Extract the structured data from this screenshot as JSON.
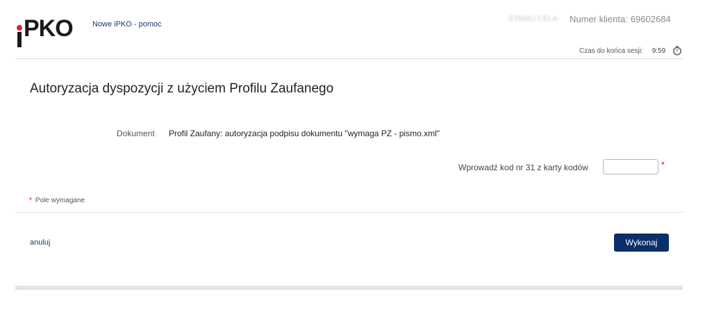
{
  "header": {
    "logo_text": "PKO",
    "logo_i": "i",
    "help_link": "Nowe iPKO - pomoc",
    "user_name": "STASIU CELA",
    "client_label": "Numer klienta:",
    "client_number": "69602684",
    "session_label": "Czas do końca sesji:",
    "session_time": "9:59",
    "timer_icon": "timer-icon"
  },
  "main": {
    "title": "Autoryzacja dyspozycji z użyciem Profilu Zaufanego",
    "document_label": "Dokument",
    "document_value": "Profil Zaufany: autoryzacja podpisu dokumentu \"wymaga PZ - pismo.xml\"",
    "code_label": "Wprowadź kod nr 31 z karty kodów",
    "code_value": "",
    "required_star": "*",
    "required_note": "Pole wymagane"
  },
  "actions": {
    "cancel_label": "anuluj",
    "submit_label": "Wykonaj"
  },
  "colors": {
    "brand_navy": "#0b2f6b",
    "brand_red": "#e4202c",
    "required_red": "#d0021b"
  }
}
